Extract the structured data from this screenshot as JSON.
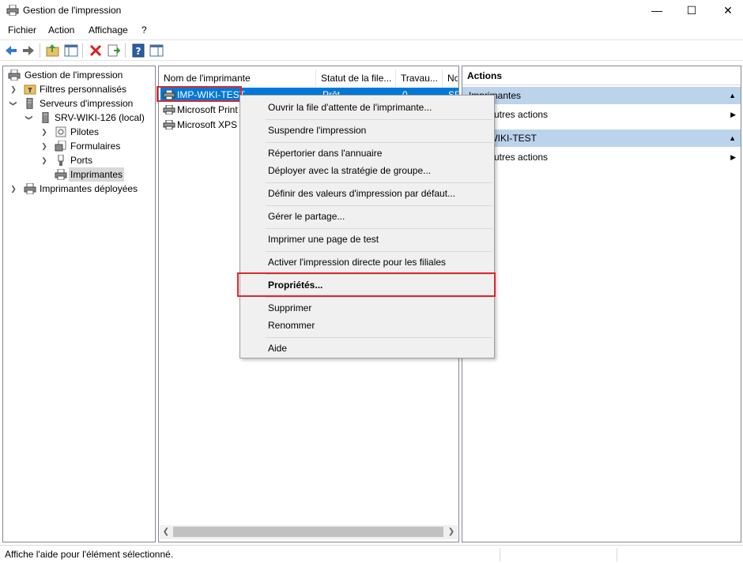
{
  "window": {
    "title": "Gestion de l'impression",
    "minimize": "—",
    "maximize": "☐",
    "close": "✕"
  },
  "menu": [
    "Fichier",
    "Action",
    "Affichage",
    "?"
  ],
  "toolbar": {
    "buttons": [
      "back-arrow-icon",
      "forward-arrow-icon",
      "up-folder-icon",
      "show-hide-tree-icon",
      "delete-icon",
      "export-list-icon",
      "help-icon",
      "show-hide-action-pane-icon"
    ]
  },
  "tree": {
    "root": "Gestion de l'impression",
    "custom_filters": "Filtres personnalisés",
    "print_servers": "Serveurs d'impression",
    "server": "SRV-WIKI-126 (local)",
    "drivers": "Pilotes",
    "forms": "Formulaires",
    "ports": "Ports",
    "printers": "Imprimantes",
    "deployed": "Imprimantes déployées"
  },
  "list": {
    "columns": [
      "Nom de l'imprimante",
      "Statut de la file...",
      "Travau...",
      "Nc"
    ],
    "rows": [
      {
        "name": "IMP-WIKI-TEST",
        "status": "Prêt",
        "jobs": "0",
        "server": "SR"
      },
      {
        "name": "Microsoft Print",
        "status": "",
        "jobs": "",
        "server": ""
      },
      {
        "name": "Microsoft XPS D",
        "status": "",
        "jobs": "",
        "server": ""
      }
    ]
  },
  "actions": {
    "header": "Actions",
    "section1": "Imprimantes",
    "more1": "Autres actions",
    "section2": "IMP-WIKI-TEST",
    "more2": "Autres actions"
  },
  "context_menu": {
    "open_queue": "Ouvrir la file d'attente de l'imprimante...",
    "pause": "Suspendre l'impression",
    "list_directory": "Répertorier dans l'annuaire",
    "deploy_gpo": "Déployer avec la stratégie de groupe...",
    "defaults": "Définir des valeurs d'impression par défaut...",
    "sharing": "Gérer le partage...",
    "test_page": "Imprimer une page de test",
    "branch_office": "Activer l'impression directe pour les filiales",
    "properties": "Propriétés...",
    "delete": "Supprimer",
    "rename": "Renommer",
    "help": "Aide"
  },
  "status_bar": "Affiche l'aide pour l'élément sélectionné.",
  "colors": {
    "selection": "#0078d7",
    "action_section": "#bcd3ec",
    "highlight": "#d9292f"
  }
}
